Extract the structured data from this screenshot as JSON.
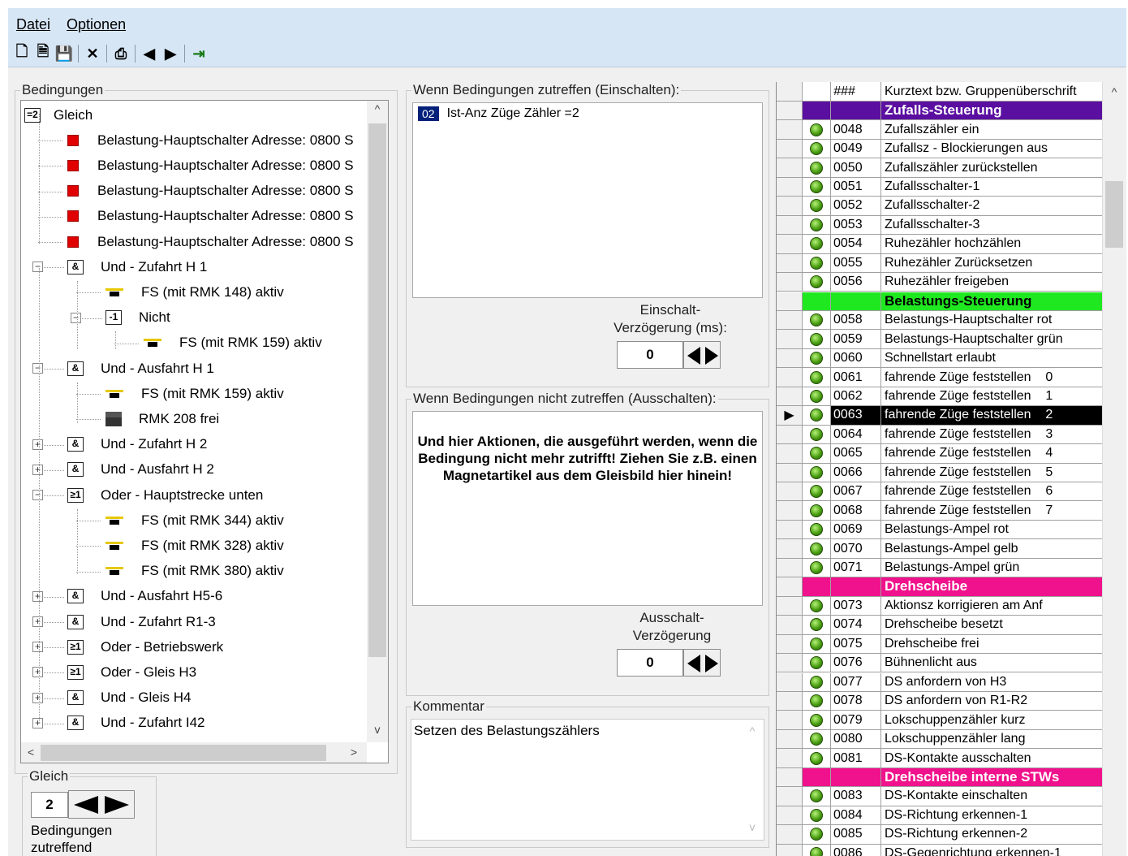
{
  "menu": {
    "file": "Datei",
    "options": "Optionen"
  },
  "toolbar": {
    "icons": [
      "new-icon",
      "open-icon",
      "save-icon",
      "delete-icon",
      "print-icon",
      "back-icon",
      "forward-icon",
      "exit-icon"
    ],
    "glyphs": {
      "new": "🗋",
      "open": "🗎",
      "save": "💾",
      "delete": "✕",
      "print": "⎙",
      "back": "◀",
      "forward": "▶",
      "exit": "⇥"
    }
  },
  "conditions": {
    "title": "Bedingungen",
    "root": {
      "badge": "=2",
      "label": "Gleich"
    },
    "items": [
      {
        "label": "Belastung-Hauptschalter Adresse: 0800 S"
      },
      {
        "label": "Belastung-Hauptschalter Adresse: 0800 S"
      },
      {
        "label": "Belastung-Hauptschalter Adresse: 0800 S"
      },
      {
        "label": "Belastung-Hauptschalter Adresse: 0800 S"
      },
      {
        "label": "Belastung-Hauptschalter Adresse: 0800 S"
      },
      {
        "label": "Und - Zufahrt H 1",
        "badge": "&"
      },
      {
        "label": "FS (mit RMK 148) aktiv"
      },
      {
        "label": "Nicht",
        "badge": "-1"
      },
      {
        "label": "FS (mit RMK 159) aktiv"
      },
      {
        "label": "Und - Ausfahrt H 1",
        "badge": "&"
      },
      {
        "label": "FS (mit RMK 159) aktiv"
      },
      {
        "label": "RMK 208 frei"
      },
      {
        "label": "Und - Zufahrt H 2",
        "badge": "&"
      },
      {
        "label": "Und - Ausfahrt H 2",
        "badge": "&"
      },
      {
        "label": "Oder - Hauptstrecke unten",
        "badge": "≥1"
      },
      {
        "label": "FS (mit RMK 344) aktiv"
      },
      {
        "label": "FS (mit RMK 328) aktiv"
      },
      {
        "label": "FS (mit RMK 380) aktiv"
      },
      {
        "label": "Und - Ausfahrt H5-6",
        "badge": "&"
      },
      {
        "label": "Und - Zufahrt R1-3",
        "badge": "&"
      },
      {
        "label": "Oder - Betriebswerk",
        "badge": "≥1"
      },
      {
        "label": "Oder - Gleis  H3",
        "badge": "≥1"
      },
      {
        "label": "Und - Gleis  H4",
        "badge": "&"
      },
      {
        "label": "Und - Zufahrt  I42",
        "badge": "&"
      }
    ],
    "expander": {
      "collapse": "−",
      "expand": "+"
    },
    "scroll": {
      "up": "^",
      "down": "v",
      "left": "<",
      "right": ">"
    }
  },
  "counter": {
    "title": "Gleich",
    "value": "2",
    "label_line1": "Bedingungen",
    "label_line2": "zutreffend"
  },
  "on_actions": {
    "title": "Wenn Bedingungen zutreffen (Einschalten):",
    "item_badge": "02",
    "item_text": "Ist-Anz Züge Zähler =2",
    "delay_label_line1": "Einschalt-",
    "delay_label_line2": "Verzögerung (ms):",
    "delay_value": "0"
  },
  "off_actions": {
    "title": "Wenn Bedingungen nicht zutreffen (Ausschalten):",
    "hint": "Und hier Aktionen, die ausgeführt werden, wenn die Bedingung nicht mehr zutrifft! Ziehen Sie z.B. einen Magnetartikel aus dem Gleisbild hier hinein!",
    "delay_label_line1": "Ausschalt-",
    "delay_label_line2": "Verzögerung",
    "delay_value": "0"
  },
  "comment": {
    "title": "Kommentar",
    "text": "Setzen des Belastungszählers"
  },
  "list": {
    "header": {
      "num": "###",
      "text": "Kurztext bzw. Gruppenüberschrift"
    },
    "colors": {
      "purple": "#5b0fa0",
      "green": "#20e820",
      "pink": "#f0128c"
    },
    "selected_marker": "▶",
    "rows": [
      {
        "type": "group",
        "text": "Zufalls-Steuerung",
        "color": "#5b0fa0",
        "fg": "#ffffff"
      },
      {
        "num": "0048",
        "text": "Zufallszähler ein"
      },
      {
        "num": "0049",
        "text": "Zufallsz - Blockierungen aus"
      },
      {
        "num": "0050",
        "text": "Zufallszähler zurückstellen"
      },
      {
        "num": "0051",
        "text": "Zufallsschalter-1"
      },
      {
        "num": "0052",
        "text": "Zufallsschalter-2"
      },
      {
        "num": "0053",
        "text": "Zufallsschalter-3"
      },
      {
        "num": "0054",
        "text": "Ruhezähler hochzählen"
      },
      {
        "num": "0055",
        "text": "Ruhezähler Zurücksetzen"
      },
      {
        "num": "0056",
        "text": "Ruhezähler freigeben"
      },
      {
        "type": "group",
        "text": "Belastungs-Steuerung",
        "color": "#20e820",
        "fg": "#000000"
      },
      {
        "num": "0058",
        "text": "Belastungs-Hauptschalter rot"
      },
      {
        "num": "0059",
        "text": "Belastungs-Hauptschalter grün"
      },
      {
        "num": "0060",
        "text": "Schnellstart erlaubt"
      },
      {
        "num": "0061",
        "text": "fahrende Züge feststellen    0"
      },
      {
        "num": "0062",
        "text": "fahrende Züge feststellen    1"
      },
      {
        "num": "0063",
        "text": "fahrende Züge feststellen    2",
        "selected": true
      },
      {
        "num": "0064",
        "text": "fahrende Züge feststellen    3"
      },
      {
        "num": "0065",
        "text": "fahrende Züge feststellen    4"
      },
      {
        "num": "0066",
        "text": "fahrende Züge feststellen    5"
      },
      {
        "num": "0067",
        "text": "fahrende Züge feststellen    6"
      },
      {
        "num": "0068",
        "text": "fahrende Züge feststellen    7"
      },
      {
        "num": "0069",
        "text": "Belastungs-Ampel rot"
      },
      {
        "num": "0070",
        "text": "Belastungs-Ampel gelb"
      },
      {
        "num": "0071",
        "text": "Belastungs-Ampel grün"
      },
      {
        "type": "group",
        "text": "Drehscheibe",
        "color": "#f0128c",
        "fg": "#ffffff"
      },
      {
        "num": "0073",
        "text": "Aktionsz korrigieren am Anf"
      },
      {
        "num": "0074",
        "text": "Drehscheibe besetzt"
      },
      {
        "num": "0075",
        "text": "Drehscheibe frei"
      },
      {
        "num": "0076",
        "text": "Bühnenlicht aus"
      },
      {
        "num": "0077",
        "text": "DS anfordern von H3"
      },
      {
        "num": "0078",
        "text": "DS anfordern von R1-R2"
      },
      {
        "num": "0079",
        "text": "Lokschuppenzähler kurz"
      },
      {
        "num": "0080",
        "text": "Lokschuppenzähler lang"
      },
      {
        "num": "0081",
        "text": "DS-Kontakte ausschalten"
      },
      {
        "type": "group",
        "text": "Drehscheibe interne STWs",
        "color": "#f0128c",
        "fg": "#ffffff"
      },
      {
        "num": "0083",
        "text": "DS-Kontakte einschalten"
      },
      {
        "num": "0084",
        "text": "DS-Richtung erkennen-1"
      },
      {
        "num": "0085",
        "text": "DS-Richtung erkennen-2"
      },
      {
        "num": "0086",
        "text": "DS-Gegenrichtung erkennen-1"
      }
    ]
  }
}
